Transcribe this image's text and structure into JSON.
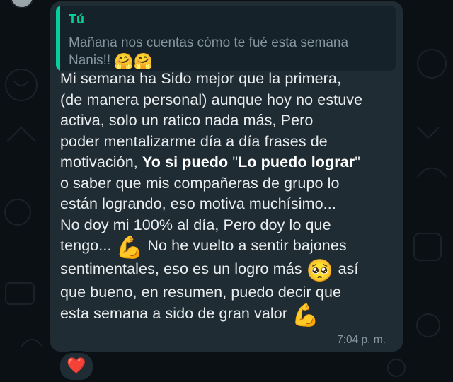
{
  "chat": {
    "quoted": {
      "author": "Tú",
      "text_line1": "Mañana nos cuentas cómo te fué esta semana",
      "text_line2": "Nanis!!",
      "emojis": "🤗🤗"
    },
    "message": {
      "l1": "Mi semana ha Sido mejor que la primera,",
      "l2": "(de manera personal) aunque hoy no estuve",
      "l3": "activa, solo un ratico nada más, Pero",
      "l4": "poder mentalizarme día a día frases de",
      "l5a": "motivación, ",
      "l5b": "Yo si puedo",
      "l5c": " \"",
      "l5d": "Lo puedo lograr",
      "l5e": "\"",
      "l6": "o saber que mis compañeras de grupo lo",
      "l7": "están logrando, eso motiva muchísimo...",
      "l8": "No doy mi 100% al día, Pero doy lo que",
      "l9a": "tengo...",
      "l9b": "No he vuelto a sentir bajones",
      "l10a": "sentimentales, eso es un logro más",
      "l10b": "así",
      "l11": "que bueno, en resumen, puedo decir que",
      "l12": "esta semana a sido de gran valor",
      "emoji_muscle": "💪",
      "emoji_pleading": "🥺"
    },
    "time": "7:04 p. m.",
    "reaction": "❤️"
  },
  "colors": {
    "background": "#0b1014",
    "bubble": "#1f2c33",
    "quote_accent": "#06cf9c",
    "text": "#e9edef",
    "meta": "#8696a0"
  }
}
